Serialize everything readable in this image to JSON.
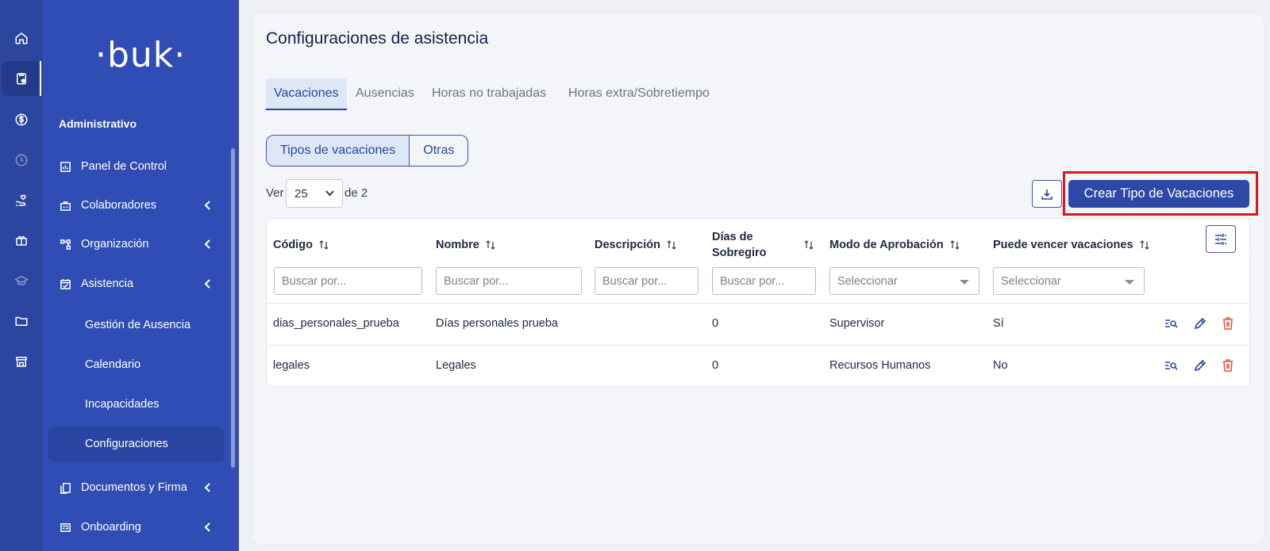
{
  "rail": {
    "icons": [
      "home-icon",
      "clipboard-icon",
      "dollar-icon",
      "clock-icon",
      "hand-heart-icon",
      "gift-icon",
      "graduation-cap-icon",
      "folder-icon",
      "store-icon"
    ]
  },
  "sidebar": {
    "logo": "·buk·",
    "section_title": "Administrativo",
    "items": [
      {
        "label": "Panel de Control"
      },
      {
        "label": "Colaboradores"
      },
      {
        "label": "Organización"
      },
      {
        "label": "Asistencia"
      },
      {
        "label": "Documentos y Firma"
      },
      {
        "label": "Onboarding"
      }
    ],
    "sub_items": [
      {
        "label": "Gestión de Ausencia"
      },
      {
        "label": "Calendario"
      },
      {
        "label": "Incapacidades"
      },
      {
        "label": "Configuraciones"
      }
    ]
  },
  "main": {
    "title": "Configuraciones de asistencia",
    "tabs": [
      {
        "label": "Vacaciones"
      },
      {
        "label": "Ausencias"
      },
      {
        "label": "Horas no trabajadas"
      },
      {
        "label": "Horas extra/Sobretiempo"
      }
    ],
    "segments": [
      {
        "label": "Tipos de vacaciones"
      },
      {
        "label": "Otras"
      }
    ],
    "pagination": {
      "ver_label": "Ver",
      "per_page": "25",
      "of_label": "de 2"
    },
    "create_button": "Crear Tipo de Vacaciones"
  },
  "table": {
    "columns": [
      {
        "label": "Código"
      },
      {
        "label": "Nombre"
      },
      {
        "label": "Descripción"
      },
      {
        "label_line1": "Días de",
        "label_line2": "Sobregiro"
      },
      {
        "label": "Modo de Aprobación"
      },
      {
        "label": "Puede vencer vacaciones"
      }
    ],
    "filters": {
      "search_placeholder": "Buscar por...",
      "select_placeholder": "Seleccionar"
    },
    "rows": [
      {
        "codigo": "dias_personales_prueba",
        "nombre": "Días personales prueba",
        "descripcion": "",
        "dias_sobregiro": "0",
        "modo_aprobacion": "Supervisor",
        "puede_vencer": "Sí"
      },
      {
        "codigo": "legales",
        "nombre": "Legales",
        "descripcion": "",
        "dias_sobregiro": "0",
        "modo_aprobacion": "Recursos Humanos",
        "puede_vencer": "No"
      }
    ]
  },
  "colors": {
    "primary": "#2c46a0",
    "sidebar": "#2f4db4",
    "highlight": "#e0141b",
    "delete": "#e5533d"
  }
}
